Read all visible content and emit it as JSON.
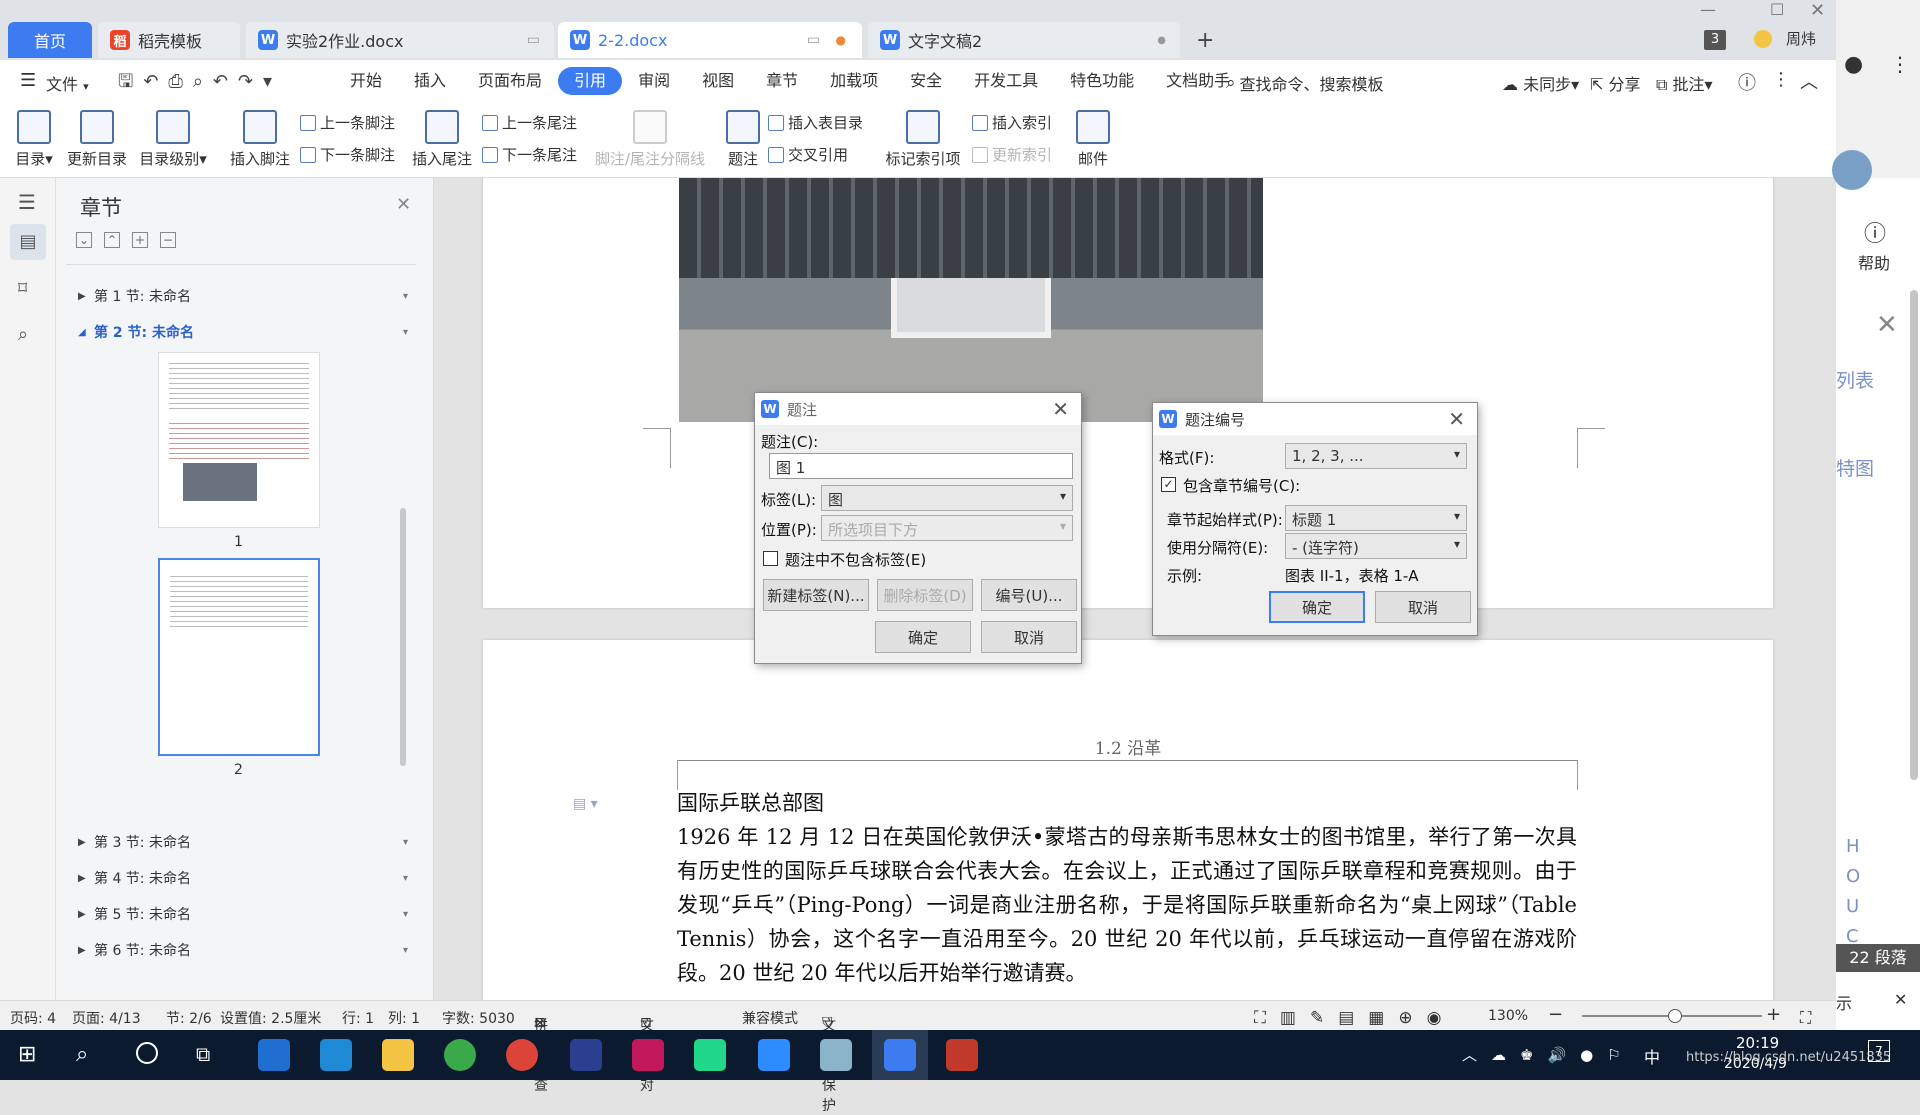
{
  "tabs": {
    "home": "首页",
    "t1": "稻壳模板",
    "t2": "实验2作业.docx",
    "t3": "2-2.docx",
    "t4": "文字文稿2",
    "add": "+"
  },
  "window": {
    "badge": "3",
    "user": "周炜"
  },
  "menu": {
    "file": "文件",
    "items": [
      "开始",
      "插入",
      "页面布局",
      "引用",
      "审阅",
      "视图",
      "章节",
      "加载项",
      "安全",
      "开发工具",
      "特色功能",
      "文档助手"
    ],
    "search": "查找命令、搜索模板",
    "sync": "未同步",
    "share": "分享",
    "comment": "批注"
  },
  "ribbon": {
    "toc": "目录",
    "update_toc": "更新目录",
    "toc_level": "目录级别",
    "insert_footnote": "插入脚注",
    "prev_footnote": "上一条脚注",
    "next_footnote": "下一条脚注",
    "insert_endnote": "插入尾注",
    "prev_endnote": "上一条尾注",
    "next_endnote": "下一条尾注",
    "separator": "脚注/尾注分隔线",
    "caption": "题注",
    "insert_table_toc": "插入表目录",
    "cross_ref": "交叉引用",
    "mark_index": "标记索引项",
    "insert_index": "插入索引",
    "update_index": "更新索引",
    "mail": "邮件"
  },
  "nav": {
    "title": "章节",
    "sections": [
      "第 1 节: 未命名",
      "第 2 节: 未命名",
      "第 3 节: 未命名",
      "第 4 节: 未命名",
      "第 5 节: 未命名",
      "第 6 节: 未命名"
    ],
    "page1": "1",
    "page2": "2"
  },
  "doc": {
    "header": "1.2 沿革",
    "caption_line": "国际乒联总部图",
    "body": "1926 年 12 月 12 日在英国伦敦伊沃•蒙塔古的母亲斯韦思林女士的图书馆里，举行了第一次具有历史性的国际乒乓球联合会代表大会。在会议上，正式通过了国际乒联章程和竞赛规则。由于发现“乒乓”（Ping-Pong）一词是商业注册名称，于是将国际乒联重新命名为“桌上网球”（Table Tennis）协会，这个名字一直沿用至今。20 世纪 20 年代以前，乒乓球运动一直停留在游戏阶段。20 世纪 20 年代以后开始举行邀请赛。"
  },
  "caption_dialog": {
    "title": "题注",
    "caption_label": "题注(C):",
    "caption_value": "图 1",
    "label_label": "标签(L):",
    "label_value": "图",
    "position_label": "位置(P):",
    "position_value": "所选项目下方",
    "exclude_label": "题注中不包含标签(E)",
    "new_label": "新建标签(N)...",
    "delete_label": "删除标签(D)",
    "numbering": "编号(U)...",
    "ok": "确定",
    "cancel": "取消"
  },
  "numbering_dialog": {
    "title": "题注编号",
    "format_label": "格式(F):",
    "format_value": "1, 2, 3, ...",
    "include_chapter": "包含章节编号(C):",
    "chapter_style_label": "章节起始样式(P):",
    "chapter_style_value": "标题 1",
    "separator_label": "使用分隔符(E):",
    "separator_value": "- (连字符)",
    "example_label": "示例:",
    "example_value": "图表 II-1，表格 1-A",
    "ok": "确定",
    "cancel": "取消"
  },
  "status": {
    "page_code": "页码: 4",
    "page": "页面: 4/13",
    "section": "节: 2/6",
    "setting": "设置值: 2.5厘米",
    "row": "行: 1",
    "col": "列: 1",
    "words": "字数: 5030",
    "spell": "拼写检查",
    "proof": "文档校对",
    "compat": "兼容模式",
    "protect": "文档未保护",
    "zoom": "130%"
  },
  "right_panel": {
    "help": "帮助",
    "list": "列表",
    "feature": "特图",
    "letters": [
      "H",
      "O",
      "U",
      "C"
    ],
    "para": "22 段落",
    "show": "示"
  },
  "taskbar": {
    "time": "20:19",
    "date": "2020/4/9",
    "ime": "中",
    "url": "https://blog.csdn.net/u2451835",
    "notif": "7"
  }
}
